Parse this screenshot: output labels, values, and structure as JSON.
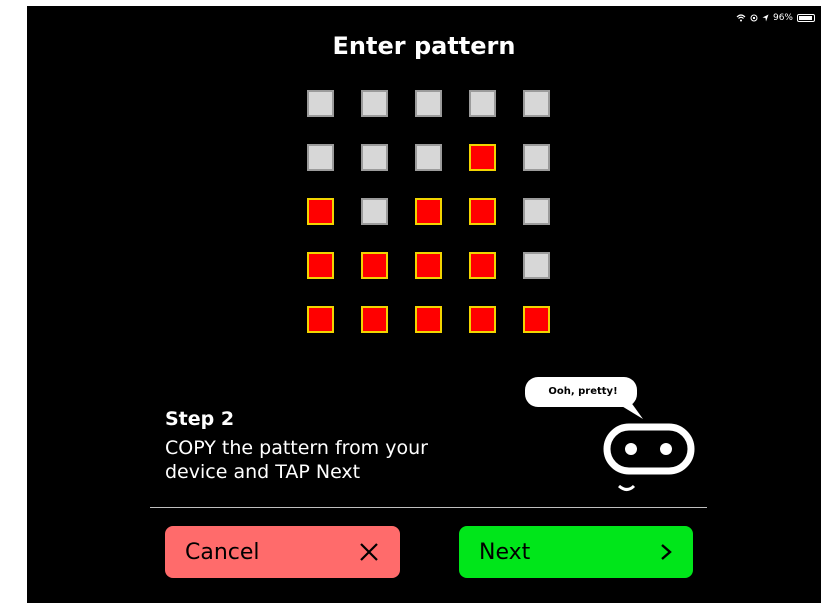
{
  "status_bar": {
    "battery": "96%"
  },
  "title": "Enter pattern",
  "pattern": [
    [
      false,
      false,
      false,
      false,
      false
    ],
    [
      false,
      false,
      false,
      true,
      false
    ],
    [
      true,
      false,
      true,
      true,
      false
    ],
    [
      true,
      true,
      true,
      true,
      false
    ],
    [
      true,
      true,
      true,
      true,
      true
    ]
  ],
  "step": {
    "title": "Step 2",
    "instruction_line1": "COPY the pattern from your",
    "instruction_line2": "device and TAP Next"
  },
  "mascot": {
    "speech": "Ooh, pretty!"
  },
  "buttons": {
    "cancel": "Cancel",
    "next": "Next"
  },
  "colors": {
    "led_on": "#ff0000",
    "led_on_border": "#f2d400",
    "led_off": "#d7d7d7",
    "cancel_bg": "#ff6b6b",
    "next_bg": "#00e61a"
  }
}
